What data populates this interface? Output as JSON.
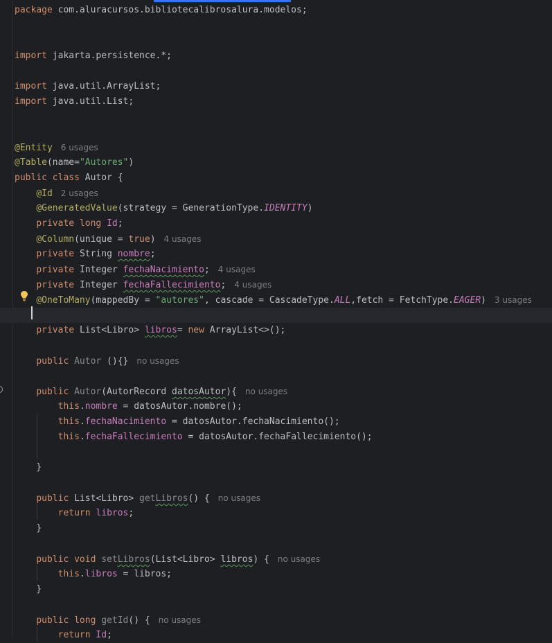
{
  "editor": {
    "lines": [
      {
        "row": 0,
        "tokens": [
          [
            "kw",
            "package "
          ],
          [
            "plain",
            "com.aluracursos.bibliotecalibrosalura.modelos;"
          ]
        ]
      },
      {
        "row": 3,
        "tokens": [
          [
            "kw",
            "import "
          ],
          [
            "plain",
            "jakarta.persistence.*;"
          ]
        ]
      },
      {
        "row": 5,
        "tokens": [
          [
            "kw",
            "import "
          ],
          [
            "plain",
            "java.util.ArrayList;"
          ]
        ]
      },
      {
        "row": 6,
        "tokens": [
          [
            "kw",
            "import "
          ],
          [
            "plain",
            "java.util.List;"
          ]
        ]
      },
      {
        "row": 9,
        "tokens": [
          [
            "ann",
            "@Entity"
          ]
        ],
        "hint": "6 usages"
      },
      {
        "row": 10,
        "tokens": [
          [
            "ann",
            "@Table"
          ],
          [
            "plain",
            "(name="
          ],
          [
            "str",
            "\"Autores\""
          ],
          [
            "plain",
            ")"
          ]
        ]
      },
      {
        "row": 11,
        "tokens": [
          [
            "kw",
            "public class "
          ],
          [
            "plain",
            "Autor {"
          ]
        ]
      },
      {
        "row": 12,
        "tokens": [
          [
            "plain",
            "    "
          ],
          [
            "ann",
            "@Id"
          ]
        ],
        "hint": "2 usages"
      },
      {
        "row": 13,
        "tokens": [
          [
            "plain",
            "    "
          ],
          [
            "ann",
            "@GeneratedValue"
          ],
          [
            "plain",
            "(strategy = GenerationType."
          ],
          [
            "fldi",
            "IDENTITY"
          ],
          [
            "plain",
            ")"
          ]
        ]
      },
      {
        "row": 14,
        "tokens": [
          [
            "plain",
            "    "
          ],
          [
            "kw",
            "private long "
          ],
          [
            "fld",
            "Id"
          ],
          [
            "plain",
            ";"
          ]
        ]
      },
      {
        "row": 15,
        "tokens": [
          [
            "plain",
            "    "
          ],
          [
            "ann",
            "@Column"
          ],
          [
            "plain",
            "(unique = "
          ],
          [
            "kw",
            "true"
          ],
          [
            "plain",
            ")"
          ]
        ],
        "hint": "4 usages"
      },
      {
        "row": 16,
        "tokens": [
          [
            "plain",
            "    "
          ],
          [
            "kw",
            "private "
          ],
          [
            "plain",
            "String "
          ],
          [
            "fld wavy",
            "nombre"
          ],
          [
            "plain",
            ";"
          ]
        ]
      },
      {
        "row": 17,
        "tokens": [
          [
            "plain",
            "    "
          ],
          [
            "kw",
            "private "
          ],
          [
            "plain",
            "Integer "
          ],
          [
            "fld wavy",
            "fechaNacimiento"
          ],
          [
            "plain",
            ";"
          ]
        ],
        "hint": "4 usages"
      },
      {
        "row": 18,
        "tokens": [
          [
            "plain",
            "    "
          ],
          [
            "kw",
            "private "
          ],
          [
            "plain",
            "Integer "
          ],
          [
            "fld wavy",
            "fechaFallecimiento"
          ],
          [
            "plain",
            ";"
          ]
        ],
        "hint": "4 usages"
      },
      {
        "row": 19,
        "tokens": [
          [
            "plain",
            "    "
          ],
          [
            "ann",
            "@OneToMany"
          ],
          [
            "plain",
            "(mappedBy = "
          ],
          [
            "str",
            "\"autores\""
          ],
          [
            "plain",
            ", cascade = CascadeType."
          ],
          [
            "fldi",
            "ALL"
          ],
          [
            "plain",
            ",fetch = FetchType."
          ],
          [
            "fldi",
            "EAGER"
          ],
          [
            "plain",
            ")"
          ]
        ],
        "hint": "3 usages"
      },
      {
        "row": 20,
        "tokens": [],
        "current": true
      },
      {
        "row": 21,
        "tokens": [
          [
            "plain",
            "    "
          ],
          [
            "kw",
            "private "
          ],
          [
            "plain",
            "List<Libro> "
          ],
          [
            "fld wavy",
            "libros"
          ],
          [
            "plain",
            "= "
          ],
          [
            "kw",
            "new "
          ],
          [
            "plain",
            "ArrayList<>();"
          ]
        ]
      },
      {
        "row": 23,
        "tokens": [
          [
            "plain",
            "    "
          ],
          [
            "kw",
            "public "
          ],
          [
            "unused",
            "Autor"
          ],
          [
            "plain",
            " (){}"
          ]
        ],
        "hint": "no usages"
      },
      {
        "row": 25,
        "tokens": [
          [
            "plain",
            "    "
          ],
          [
            "kw",
            "public "
          ],
          [
            "unused",
            "Autor"
          ],
          [
            "plain",
            "(AutorRecord "
          ],
          [
            "plain wavy",
            "datosAutor"
          ],
          [
            "plain",
            "){"
          ]
        ],
        "hint": "no usages"
      },
      {
        "row": 26,
        "tokens": [
          [
            "plain",
            "        "
          ],
          [
            "kw",
            "this"
          ],
          [
            "plain",
            "."
          ],
          [
            "fld",
            "nombre"
          ],
          [
            "plain",
            " = datosAutor.nombre();"
          ]
        ]
      },
      {
        "row": 27,
        "tokens": [
          [
            "plain",
            "        "
          ],
          [
            "kw",
            "this"
          ],
          [
            "plain",
            "."
          ],
          [
            "fld",
            "fechaNacimiento"
          ],
          [
            "plain",
            " = datosAutor.fechaNacimiento();"
          ]
        ]
      },
      {
        "row": 28,
        "tokens": [
          [
            "plain",
            "        "
          ],
          [
            "kw",
            "this"
          ],
          [
            "plain",
            "."
          ],
          [
            "fld",
            "fechaFallecimiento"
          ],
          [
            "plain",
            " = datosAutor.fechaFallecimiento();"
          ]
        ]
      },
      {
        "row": 30,
        "tokens": [
          [
            "plain",
            "    }"
          ]
        ]
      },
      {
        "row": 32,
        "tokens": [
          [
            "plain",
            "    "
          ],
          [
            "kw",
            "public "
          ],
          [
            "plain",
            "List<Libro> "
          ],
          [
            "unused",
            "get"
          ],
          [
            "unused wavy",
            "Libros"
          ],
          [
            "plain",
            "() {"
          ]
        ],
        "hint": "no usages"
      },
      {
        "row": 33,
        "tokens": [
          [
            "plain",
            "        "
          ],
          [
            "kw",
            "return "
          ],
          [
            "fld",
            "libros"
          ],
          [
            "plain",
            ";"
          ]
        ]
      },
      {
        "row": 34,
        "tokens": [
          [
            "plain",
            "    }"
          ]
        ]
      },
      {
        "row": 36,
        "tokens": [
          [
            "plain",
            "    "
          ],
          [
            "kw",
            "public void "
          ],
          [
            "unused",
            "set"
          ],
          [
            "unused wavy",
            "Libros"
          ],
          [
            "plain",
            "(List<Libro> "
          ],
          [
            "plain wavy",
            "libros"
          ],
          [
            "plain",
            ") {"
          ]
        ],
        "hint": "no usages"
      },
      {
        "row": 37,
        "tokens": [
          [
            "plain",
            "        "
          ],
          [
            "kw",
            "this"
          ],
          [
            "plain",
            "."
          ],
          [
            "fld",
            "libros"
          ],
          [
            "plain",
            " = libros;"
          ]
        ]
      },
      {
        "row": 38,
        "tokens": [
          [
            "plain",
            "    }"
          ]
        ]
      },
      {
        "row": 40,
        "tokens": [
          [
            "plain",
            "    "
          ],
          [
            "kw",
            "public long "
          ],
          [
            "unused",
            "getId"
          ],
          [
            "plain",
            "() {"
          ]
        ],
        "hint": "no usages"
      },
      {
        "row": 41,
        "tokens": [
          [
            "plain",
            "        "
          ],
          [
            "kw",
            "return "
          ],
          [
            "fld",
            "Id"
          ],
          [
            "plain",
            ";"
          ]
        ]
      }
    ]
  },
  "icons": {
    "intention": "lightbulb-icon",
    "implements": "implementation-marker-icon"
  },
  "colors": {
    "background": "#1e1f22",
    "current_line": "#26282e",
    "keyword": "#cf8e6d",
    "annotation": "#b3ae60",
    "string": "#6aab73",
    "field": "#c77dbb",
    "plain": "#bcbec4",
    "hint": "#7a7e85",
    "tab_accent": "#3574f0"
  }
}
